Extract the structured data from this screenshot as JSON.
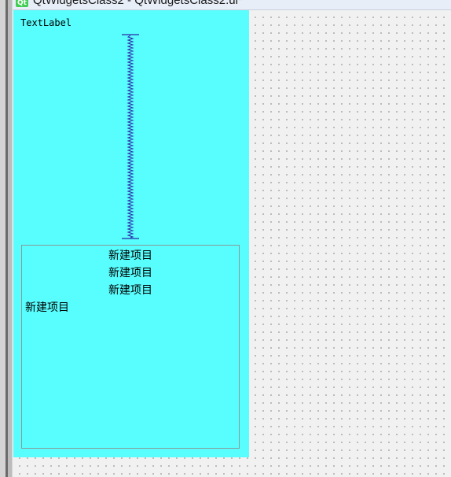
{
  "window": {
    "title": "QtWidgetsClass2 - QtWidgetsClass2.ui*",
    "icon": "qt-logo-icon",
    "icon_text": "Qt"
  },
  "form": {
    "background_color": "#58fdfd",
    "text_label": "TextLabel",
    "spacer": "vertical-spacer"
  },
  "list_widget": {
    "items": [
      {
        "text": "新建项目",
        "align": "center"
      },
      {
        "text": "新建项目",
        "align": "center"
      },
      {
        "text": "新建项目",
        "align": "center"
      },
      {
        "text": "新建项目",
        "align": "left"
      }
    ]
  },
  "colors": {
    "canvas_grid_dot": "#8c8c8c",
    "spacer_color": "#2a2aa8"
  }
}
